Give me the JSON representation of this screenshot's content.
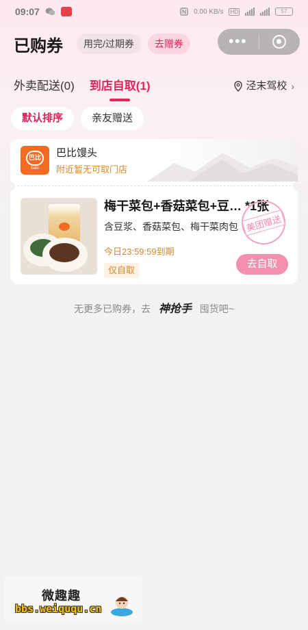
{
  "status_bar": {
    "time": "09:07",
    "network_speed": "0.00 KB/s",
    "battery": "57"
  },
  "header": {
    "title": "已购券",
    "expired_label": "用完/过期券",
    "gift_label": "去赠券"
  },
  "tabs": [
    {
      "label": "外卖配送(0)",
      "active": false
    },
    {
      "label": "到店自取(1)",
      "active": true
    }
  ],
  "location": {
    "label": "泾末驾校"
  },
  "sort_options": [
    {
      "label": "默认排序",
      "active": true
    },
    {
      "label": "亲友赠送",
      "active": false
    }
  ],
  "coupon": {
    "shop_name": "巴比馒头",
    "shop_note": "附近暂无可取门店",
    "logo_text": "巴比",
    "logo_sub": "babi",
    "item_title": "梅干菜包+香菇菜包+豆… *1张",
    "item_desc": "含豆浆、香菇菜包、梅干菜肉包",
    "expire_text": "今日23:59:59到期",
    "tag": "仅自取",
    "stamp": "美团赠送",
    "action_label": "去自取"
  },
  "footer": {
    "prefix": "无更多已购券，去",
    "brand": "神抢手",
    "suffix": "囤货吧~"
  },
  "watermark": {
    "title": "微趣趣",
    "url": "bbs.weiququ.cn"
  },
  "colors": {
    "accent": "#e0265a",
    "orange_text": "#d4892c",
    "button_pink": "#f390ac"
  }
}
